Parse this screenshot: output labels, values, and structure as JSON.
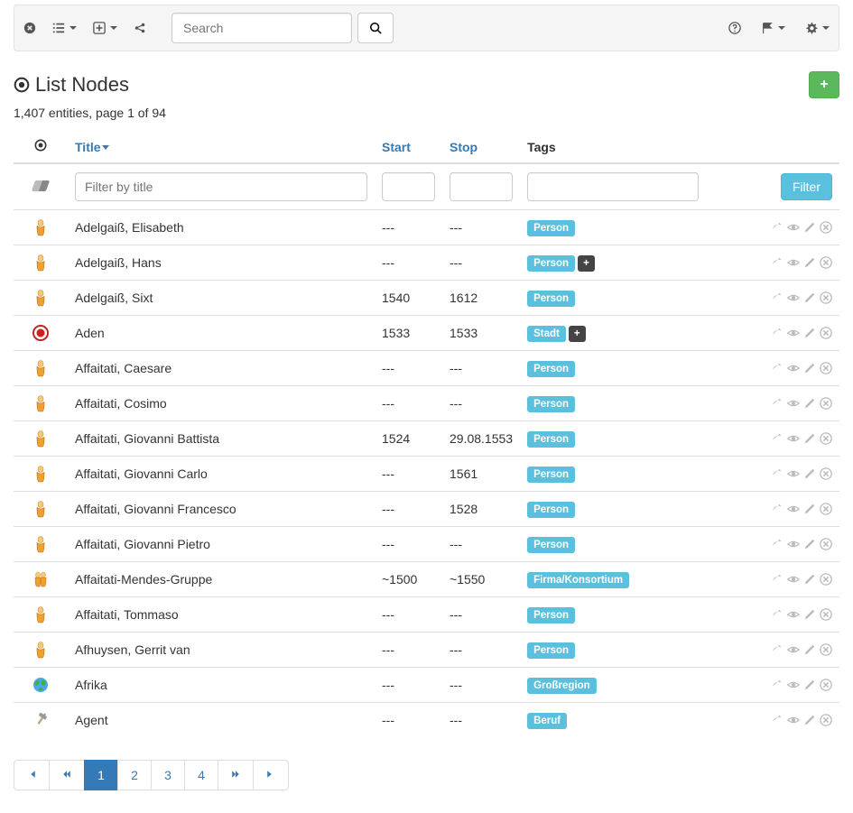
{
  "toolbar": {
    "search_placeholder": "Search"
  },
  "header": {
    "title": "List Nodes",
    "subhead": "1,407 entities, page 1 of 94"
  },
  "columns": {
    "title": "Title",
    "start": "Start",
    "stop": "Stop",
    "tags": "Tags"
  },
  "filter": {
    "title_placeholder": "Filter by title",
    "button": "Filter"
  },
  "tags": {
    "person": "Person",
    "stadt": "Stadt",
    "firma": "Firma/Konsortium",
    "grossregion": "Großregion",
    "beruf": "Beruf",
    "plus": "+"
  },
  "rows": [
    {
      "icon": "person",
      "title": "Adelgaiß, Elisabeth",
      "start": "---",
      "stop": "---",
      "tags": [
        "person"
      ],
      "plus": false
    },
    {
      "icon": "person",
      "title": "Adelgaiß, Hans",
      "start": "---",
      "stop": "---",
      "tags": [
        "person"
      ],
      "plus": true
    },
    {
      "icon": "person",
      "title": "Adelgaiß, Sixt",
      "start": "1540",
      "stop": "1612",
      "tags": [
        "person"
      ],
      "plus": false
    },
    {
      "icon": "city",
      "title": "Aden",
      "start": "1533",
      "stop": "1533",
      "tags": [
        "stadt"
      ],
      "plus": true
    },
    {
      "icon": "person",
      "title": "Affaitati, Caesare",
      "start": "---",
      "stop": "---",
      "tags": [
        "person"
      ],
      "plus": false
    },
    {
      "icon": "person",
      "title": "Affaitati, Cosimo",
      "start": "---",
      "stop": "---",
      "tags": [
        "person"
      ],
      "plus": false
    },
    {
      "icon": "person",
      "title": "Affaitati, Giovanni Battista",
      "start": "1524",
      "stop": "29.08.1553",
      "tags": [
        "person"
      ],
      "plus": false
    },
    {
      "icon": "person",
      "title": "Affaitati, Giovanni Carlo",
      "start": "---",
      "stop": "1561",
      "tags": [
        "person"
      ],
      "plus": false
    },
    {
      "icon": "person",
      "title": "Affaitati, Giovanni Francesco",
      "start": "---",
      "stop": "1528",
      "tags": [
        "person"
      ],
      "plus": false
    },
    {
      "icon": "person",
      "title": "Affaitati, Giovanni Pietro",
      "start": "---",
      "stop": "---",
      "tags": [
        "person"
      ],
      "plus": false
    },
    {
      "icon": "group",
      "title": "Affaitati-Mendes-Gruppe",
      "start": "~1500",
      "stop": "~1550",
      "tags": [
        "firma"
      ],
      "plus": false
    },
    {
      "icon": "person",
      "title": "Affaitati, Tommaso",
      "start": "---",
      "stop": "---",
      "tags": [
        "person"
      ],
      "plus": false
    },
    {
      "icon": "person",
      "title": "Afhuysen, Gerrit van",
      "start": "---",
      "stop": "---",
      "tags": [
        "person"
      ],
      "plus": false
    },
    {
      "icon": "globe",
      "title": "Afrika",
      "start": "---",
      "stop": "---",
      "tags": [
        "grossregion"
      ],
      "plus": false
    },
    {
      "icon": "hammer",
      "title": "Agent",
      "start": "---",
      "stop": "---",
      "tags": [
        "beruf"
      ],
      "plus": false
    }
  ],
  "pagination": {
    "pages": [
      "1",
      "2",
      "3",
      "4"
    ],
    "active": "1"
  }
}
